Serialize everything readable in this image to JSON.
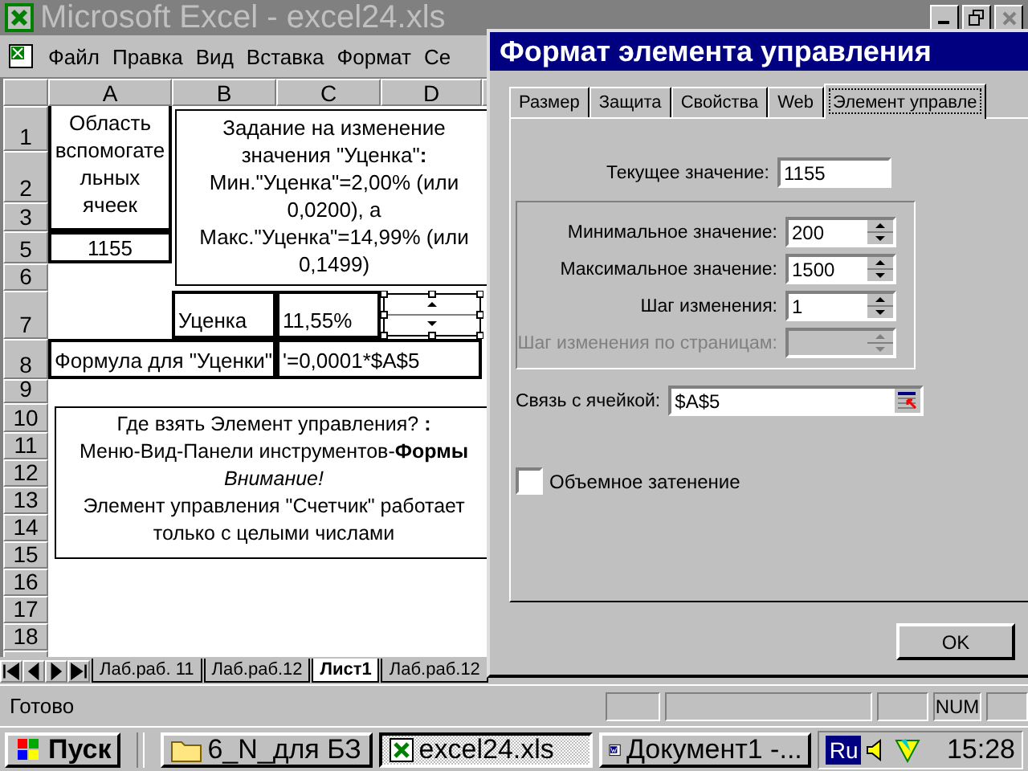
{
  "excel": {
    "title": "Microsoft Excel - excel24.xls",
    "menu": [
      "Файл",
      "Правка",
      "Вид",
      "Вставка",
      "Формат",
      "Се"
    ],
    "columns": [
      "A",
      "B",
      "C",
      "D"
    ],
    "rows": [
      "1",
      "2",
      "3",
      "5",
      "6",
      "7",
      "8",
      "9",
      "10",
      "11",
      "12",
      "13",
      "14",
      "15",
      "16",
      "17",
      "18"
    ],
    "aux_area": {
      "label": "Область вспомогательных ячеек",
      "value": "1155"
    },
    "task_note": "Задание на изменение значения \"Уценка\"**:** Мин.\"Уценка\"=2,00% (или 0,0200), а Макс.\"Уценка\"=14,99% (или 0,1499)",
    "markdown_row": {
      "label": "Уценка",
      "value": "11,55%"
    },
    "spinner": {
      "selected": true
    },
    "formula_row": {
      "label": "Формула для \"Уценки\"",
      "value": "'=0,0001*$A$5"
    },
    "hint_lines": [
      "Где взять Элемент управления? **:**",
      "Меню-Вид-Панели инструментов-**Формы**",
      "*Внимание!*",
      "Элемент управления \"Счетчик\" работает",
      "только с целыми числами"
    ],
    "sheet_tabs": [
      {
        "label": "Лаб.раб. 11",
        "selected": false
      },
      {
        "label": "Лаб.раб.12",
        "selected": false
      },
      {
        "label": "Лист1",
        "selected": true
      },
      {
        "label": "Лаб.раб.12",
        "selected": false
      }
    ],
    "status": "Готово",
    "num_indicator": "NUM"
  },
  "dialog": {
    "title": "Формат элемента управления",
    "tabs": [
      {
        "label": "Размер",
        "selected": false
      },
      {
        "label": "Защита",
        "selected": false
      },
      {
        "label": "Свойства",
        "selected": false
      },
      {
        "label": "Web",
        "selected": false
      },
      {
        "label": "Элемент управле",
        "selected": true
      }
    ],
    "current_value": {
      "label": "Текущее значение:",
      "value": "1155"
    },
    "fields": [
      {
        "label": "Минимальное значение:",
        "value": "200",
        "disabled": false
      },
      {
        "label": "Максимальное значение:",
        "value": "1500",
        "disabled": false
      },
      {
        "label": "Шаг изменения:",
        "value": "1",
        "disabled": false
      },
      {
        "label": "Шаг изменения по страницам:",
        "disabled": true
      }
    ],
    "cell_link": {
      "label": "Связь с ячейкой:",
      "value": "$A$5"
    },
    "shading": {
      "label": "Объемное затенение",
      "checked": false
    },
    "buttons": [
      "OK"
    ]
  },
  "taskbar": {
    "start": "Пуск",
    "tasks": [
      {
        "label": "6_N_для БЗ",
        "kind": "folder",
        "selected": false
      },
      {
        "label": "excel24.xls",
        "kind": "excel",
        "selected": true
      },
      {
        "label": "Документ1 -...",
        "kind": "word",
        "selected": false
      }
    ],
    "language": "Ru",
    "clock": "15:28"
  }
}
